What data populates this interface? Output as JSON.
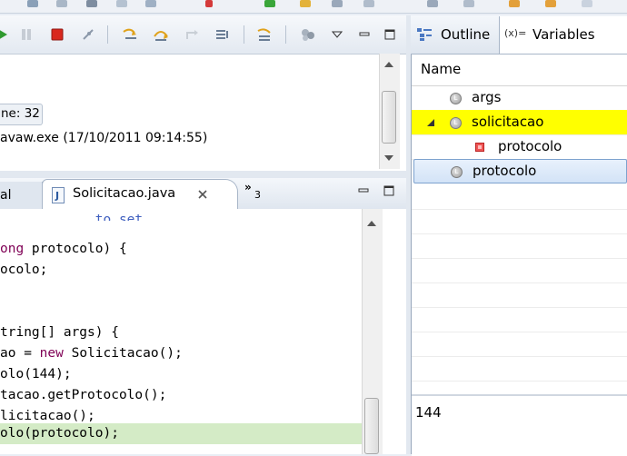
{
  "debug": {
    "line_badge": "ne: 32",
    "process_text": "avaw.exe (17/10/2011 09:14:55)"
  },
  "editor": {
    "tab_left_label": "al",
    "tab_active_label": "Solicitacao.java",
    "overflow_count": "3",
    "lines": [
      {
        "parts": [
          {
            "t": "to set",
            "c": "#3f5fbf"
          }
        ]
      },
      {
        "parts": [
          {
            "t": "ong",
            "c": "#7f0055"
          },
          {
            "t": " protocolo) {",
            "c": "#000"
          }
        ]
      },
      {
        "parts": [
          {
            "t": "ocolo;",
            "c": "#000"
          }
        ]
      },
      {
        "parts": [
          {
            "t": "",
            "c": "#000"
          }
        ]
      },
      {
        "parts": [
          {
            "t": "",
            "c": "#000"
          }
        ]
      },
      {
        "parts": [
          {
            "t": "tring[] args) {",
            "c": "#000"
          }
        ]
      },
      {
        "parts": [
          {
            "t": "ao = ",
            "c": "#000"
          },
          {
            "t": "new",
            "c": "#7f0055"
          },
          {
            "t": " Solicitacao();",
            "c": "#000"
          }
        ]
      },
      {
        "parts": [
          {
            "t": "olo(144);",
            "c": "#000"
          }
        ]
      },
      {
        "parts": [
          {
            "t": "tacao.getProtocolo();",
            "c": "#000"
          }
        ]
      },
      {
        "parts": [
          {
            "t": "licitacao();",
            "c": "#000"
          }
        ]
      },
      {
        "parts": [
          {
            "t": "olo(protocolo);",
            "c": "#000"
          }
        ]
      }
    ]
  },
  "variables": {
    "tab_outline": "Outline",
    "tab_variables_prefix": "(x)=",
    "tab_variables": "Variables",
    "column_header": "Name",
    "rows": [
      {
        "name": "args"
      },
      {
        "name": "solicitacao"
      },
      {
        "name": "protocolo"
      },
      {
        "name": "protocolo"
      }
    ],
    "detail_value": "144"
  },
  "colors": {
    "highlight_row": "#ffff00",
    "selected_row": "#dce9f8",
    "current_line": "#d4ebc6",
    "keyword": "#7f0055"
  }
}
